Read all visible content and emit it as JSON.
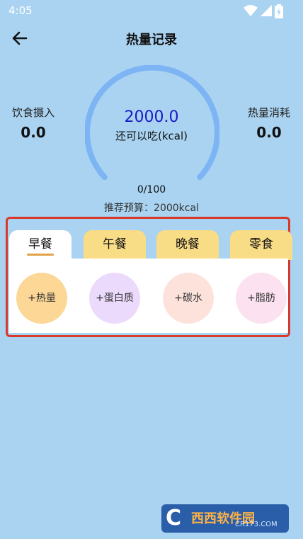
{
  "status_bar": {
    "time": "4:05"
  },
  "header": {
    "title": "热量记录"
  },
  "stats": {
    "intake_label": "饮食摄入",
    "intake_value": "0.0",
    "burn_label": "热量消耗",
    "burn_value": "0.0"
  },
  "gauge": {
    "value": "2000.0",
    "label": "还可以吃(kcal)",
    "progress_text": "0/100",
    "progress_fraction": 0,
    "budget_text": "推荐预算：2000kcal",
    "color": "#7cb4f4",
    "value_color": "#1a1bc7"
  },
  "meals": {
    "tabs": [
      {
        "label": "早餐",
        "active": true
      },
      {
        "label": "午餐",
        "active": false
      },
      {
        "label": "晚餐",
        "active": false
      },
      {
        "label": "零食",
        "active": false
      }
    ],
    "actions": [
      {
        "label": "+热量",
        "color": "#fcd795"
      },
      {
        "label": "+蛋白质",
        "color": "#ecdafd"
      },
      {
        "label": "+碳水",
        "color": "#fde2dc"
      },
      {
        "label": "+脂肪",
        "color": "#fce2f0"
      }
    ]
  },
  "watermark": {
    "brand": "西西软件园",
    "url": "CR173.COM",
    "logo_letter": "C"
  },
  "colors": {
    "background": "#a9d3f1",
    "tab_inactive": "#f9dc86",
    "highlight_border": "#d9392b"
  }
}
